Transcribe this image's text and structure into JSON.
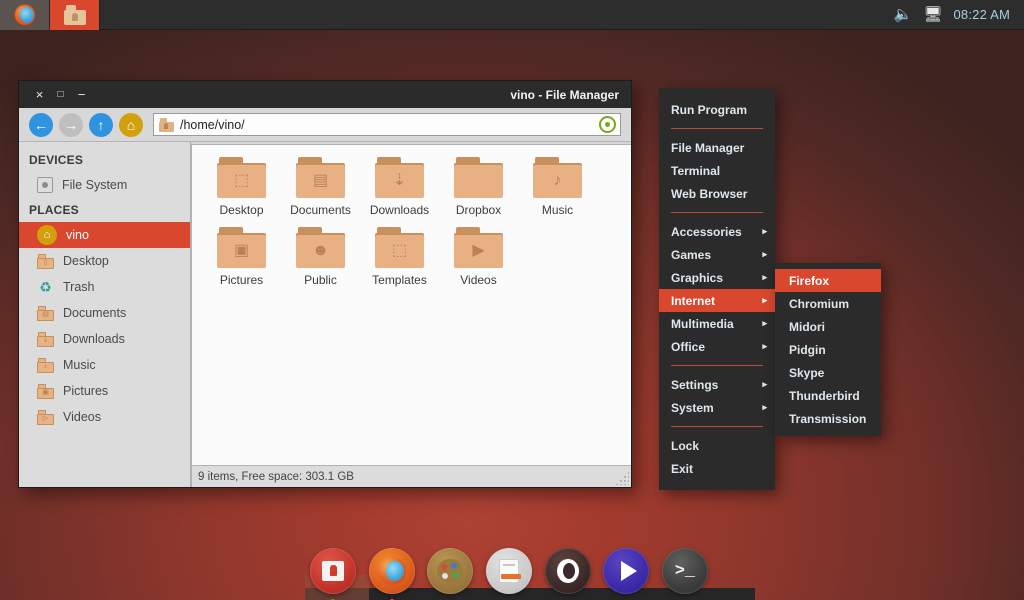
{
  "panel": {
    "tasks": [
      {
        "name": "firefox",
        "label": "Firefox",
        "active": false
      },
      {
        "name": "file-manager",
        "label": "File Manager",
        "active": true
      }
    ],
    "tray": {
      "volume_icon": "speaker-icon",
      "network_icon": "network-icon",
      "clock": "08:22 AM"
    }
  },
  "window": {
    "title": "vino - File Manager",
    "controls": {
      "close": "×",
      "maximize": "□",
      "minimize": "−"
    },
    "toolbar": {
      "back_label": "←",
      "forward_label": "→",
      "up_label": "↑",
      "home_label": "⌂",
      "path_value": "/home/vino/",
      "path_placeholder": "/home/vino/",
      "reload_icon": "reload-icon"
    },
    "sidebar": {
      "devices_header": "DEVICES",
      "devices": [
        {
          "label": "File System",
          "icon": "disk-icon"
        }
      ],
      "places_header": "PLACES",
      "places": [
        {
          "label": "vino",
          "icon": "home-icon",
          "selected": true
        },
        {
          "label": "Desktop",
          "icon": "folder-desktop-icon",
          "glyph": "⬚"
        },
        {
          "label": "Trash",
          "icon": "trash-icon"
        },
        {
          "label": "Documents",
          "icon": "folder-documents-icon",
          "glyph": "▤"
        },
        {
          "label": "Downloads",
          "icon": "folder-downloads-icon",
          "glyph": "⇣"
        },
        {
          "label": "Music",
          "icon": "folder-music-icon",
          "glyph": "♪"
        },
        {
          "label": "Pictures",
          "icon": "folder-pictures-icon",
          "glyph": "▣"
        },
        {
          "label": "Videos",
          "icon": "folder-videos-icon",
          "glyph": "▷"
        }
      ]
    },
    "files": [
      {
        "label": "Desktop",
        "glyph": "⬚"
      },
      {
        "label": "Documents",
        "glyph": "▤"
      },
      {
        "label": "Downloads",
        "glyph": "⇣"
      },
      {
        "label": "Dropbox",
        "glyph": ""
      },
      {
        "label": "Music",
        "glyph": "♪"
      },
      {
        "label": "Pictures",
        "glyph": "▣"
      },
      {
        "label": "Public",
        "glyph": "☻"
      },
      {
        "label": "Templates",
        "glyph": "⬚"
      },
      {
        "label": "Videos",
        "glyph": "▶"
      }
    ],
    "status": "9 items, Free space: 303.1 GB"
  },
  "app_menu": {
    "groups": [
      [
        {
          "label": "Run Program",
          "submenu": false
        }
      ],
      [
        {
          "label": "File Manager",
          "submenu": false
        },
        {
          "label": "Terminal",
          "submenu": false
        },
        {
          "label": "Web Browser",
          "submenu": false
        }
      ],
      [
        {
          "label": "Accessories",
          "submenu": true
        },
        {
          "label": "Games",
          "submenu": true
        },
        {
          "label": "Graphics",
          "submenu": true
        },
        {
          "label": "Internet",
          "submenu": true,
          "highlighted": true
        },
        {
          "label": "Multimedia",
          "submenu": true
        },
        {
          "label": "Office",
          "submenu": true
        }
      ],
      [
        {
          "label": "Settings",
          "submenu": true
        },
        {
          "label": "System",
          "submenu": true
        }
      ],
      [
        {
          "label": "Lock",
          "submenu": false
        },
        {
          "label": "Exit",
          "submenu": false
        }
      ]
    ],
    "arrow_glyph": "▸"
  },
  "sub_menu": {
    "parent": "Internet",
    "items": [
      {
        "label": "Firefox",
        "highlighted": true
      },
      {
        "label": "Chromium"
      },
      {
        "label": "Midori"
      },
      {
        "label": "Pidgin"
      },
      {
        "label": "Skype"
      },
      {
        "label": "Thunderbird"
      },
      {
        "label": "Transmission"
      }
    ]
  },
  "dock": {
    "items": [
      {
        "name": "file-manager",
        "label": "File Manager",
        "icon": "folder-icon",
        "running": true
      },
      {
        "name": "firefox",
        "label": "Firefox",
        "icon": "firefox-icon",
        "running": true
      },
      {
        "name": "gimp",
        "label": "GIMP",
        "icon": "palette-icon",
        "running": false
      },
      {
        "name": "text-editor",
        "label": "Text Editor",
        "icon": "document-icon",
        "running": false
      },
      {
        "name": "opera",
        "label": "Opera",
        "icon": "opera-icon",
        "running": false
      },
      {
        "name": "media-player",
        "label": "Media Player",
        "icon": "play-icon",
        "running": false
      },
      {
        "name": "terminal",
        "label": "Terminal",
        "icon": "terminal-icon",
        "running": false
      }
    ]
  },
  "colors": {
    "accent": "#d9472f",
    "panel_bg": "#2d2d2d",
    "menu_bg": "#2b2b2b",
    "desktop_center": "#a33b2e",
    "desktop_edge": "#3d231f",
    "clock_text": "#a8cfe0"
  }
}
